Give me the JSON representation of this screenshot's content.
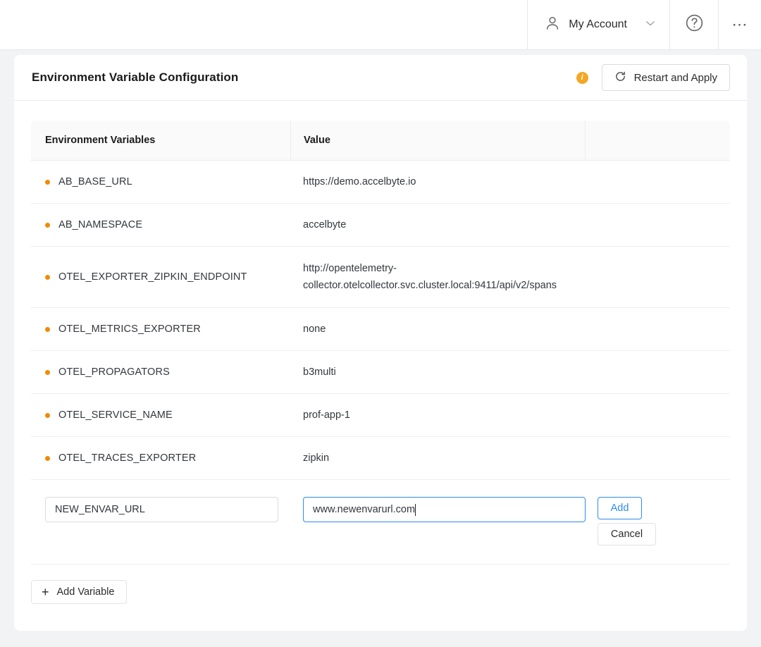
{
  "topbar": {
    "account_label": "My Account",
    "account_icon": "person-icon",
    "chevron_icon": "chevron-down-icon",
    "help_icon": "help-circle-icon",
    "more_icon": "ellipsis-icon"
  },
  "card": {
    "title": "Environment Variable Configuration",
    "info_badge": "i",
    "restart_label": "Restart and Apply",
    "restart_icon": "refresh-icon"
  },
  "table": {
    "headers": {
      "name": "Environment Variables",
      "value": "Value",
      "actions": ""
    },
    "rows": [
      {
        "name": "AB_BASE_URL",
        "value": "https://demo.accelbyte.io"
      },
      {
        "name": "AB_NAMESPACE",
        "value": "accelbyte"
      },
      {
        "name": "OTEL_EXPORTER_ZIPKIN_ENDPOINT",
        "value": "http://opentelemetry-collector.otelcollector.svc.cluster.local:9411/api/v2/spans"
      },
      {
        "name": "OTEL_METRICS_EXPORTER",
        "value": "none"
      },
      {
        "name": "OTEL_PROPAGATORS",
        "value": "b3multi"
      },
      {
        "name": "OTEL_SERVICE_NAME",
        "value": "prof-app-1"
      },
      {
        "name": "OTEL_TRACES_EXPORTER",
        "value": "zipkin"
      }
    ]
  },
  "edit_row": {
    "name_value": "NEW_ENVAR_URL",
    "name_placeholder": "",
    "value_value": "www.newenvarurl.com",
    "value_placeholder": "",
    "add_label": "Add",
    "cancel_label": "Cancel"
  },
  "footer": {
    "add_variable_label": "Add Variable",
    "plus_icon": "plus-icon"
  },
  "colors": {
    "page_background": "#f2f3f5",
    "card_background": "#ffffff",
    "bullet_orange": "#f28a00",
    "info_orange": "#f5a623",
    "accent_blue": "#2e8bf0",
    "text_primary": "#33373d",
    "border": "#ebebeb"
  }
}
